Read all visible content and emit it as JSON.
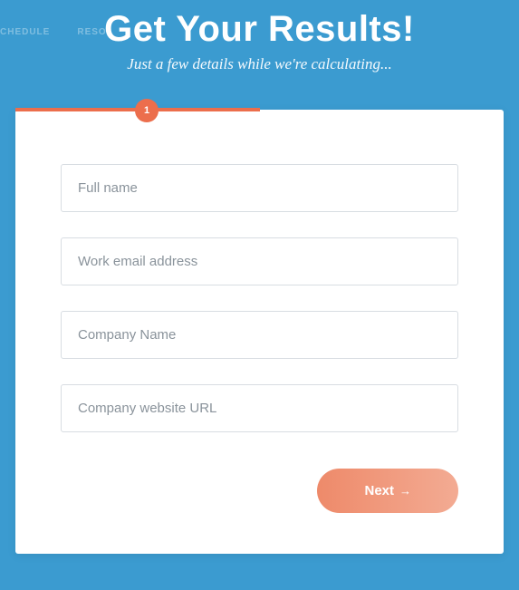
{
  "bg_nav": {
    "item1": "CHEDULE",
    "item2": "RESO"
  },
  "header": {
    "title": "Get Your Results!",
    "subtitle": "Just a few details while we're calculating..."
  },
  "progress": {
    "step": "1"
  },
  "form": {
    "fullname": {
      "placeholder": "Full name",
      "value": ""
    },
    "email": {
      "placeholder": "Work email address",
      "value": ""
    },
    "company": {
      "placeholder": "Company Name",
      "value": ""
    },
    "website": {
      "placeholder": "Company website URL",
      "value": ""
    }
  },
  "actions": {
    "next_label": "Next"
  },
  "colors": {
    "background": "#3b9bd0",
    "accent": "#ec6e4c",
    "button_gradient_start": "#ee8a6a",
    "button_gradient_end": "#f3ab93"
  }
}
